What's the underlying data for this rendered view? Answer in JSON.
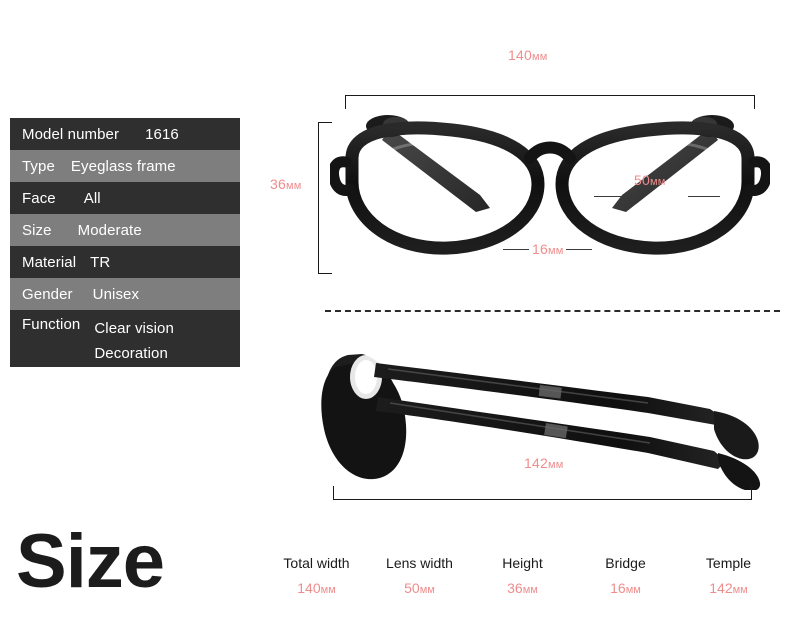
{
  "spec_table": {
    "rows": [
      {
        "key": "Model number",
        "value": "1616",
        "shade": "dark",
        "offset": "v-off-a"
      },
      {
        "key": "Type",
        "value": "Eyeglass frame",
        "shade": "light",
        "offset": "v-off-b"
      },
      {
        "key": "Face",
        "value": "All",
        "shade": "dark",
        "offset": "v-off-c"
      },
      {
        "key": "Size",
        "value": "Moderate",
        "shade": "light",
        "offset": "v-off-d"
      },
      {
        "key": "Material",
        "value": "TR",
        "shade": "dark",
        "offset": "v-off-e"
      },
      {
        "key": "Gender",
        "value": "Unisex",
        "shade": "light",
        "offset": "v-off-f"
      },
      {
        "key": "Function",
        "value": "Clear vision\nDecoration",
        "shade": "dark",
        "offset": "v-off-g",
        "tall": true
      }
    ]
  },
  "size_heading": "Size",
  "annotations": {
    "total_width": {
      "number": "140",
      "unit": "мм"
    },
    "lens_width": {
      "number": "50",
      "unit": "мм"
    },
    "height": {
      "number": "36",
      "unit": "мм"
    },
    "bridge": {
      "number": "16",
      "unit": "мм"
    },
    "temple": {
      "number": "142",
      "unit": "мм"
    }
  },
  "measure_row": {
    "columns": [
      {
        "name": "Total width",
        "number": "140",
        "unit": "мм"
      },
      {
        "name": "Lens width",
        "number": "50",
        "unit": "мм"
      },
      {
        "name": "Height",
        "number": "36",
        "unit": "мм"
      },
      {
        "name": "Bridge",
        "number": "16",
        "unit": "мм"
      },
      {
        "name": "Temple",
        "number": "142",
        "unit": "мм"
      }
    ]
  },
  "colors": {
    "accent_pink": "#ef8d8d",
    "row_dark": "#2f2f2f",
    "row_light": "#7e7e7e",
    "text_dark": "#1a1a1a",
    "frame_black": "#121212"
  }
}
